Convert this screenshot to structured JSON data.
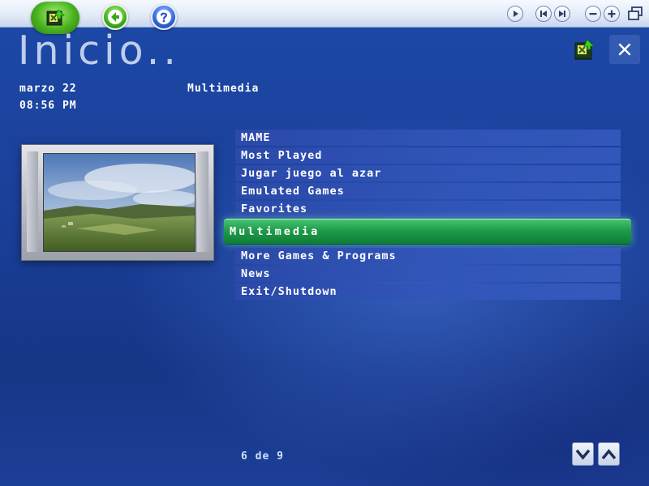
{
  "header": {
    "title": "Inicio..",
    "date": "marzo 22",
    "time": "08:56 PM",
    "section": "Multimedia"
  },
  "toolbar": {
    "home_icon": "media-center-home-icon",
    "back_icon": "back-arrow-icon",
    "help_icon": "help-icon",
    "transport_icons": [
      "play-icon",
      "previous-icon",
      "next-icon",
      "volume-down-icon",
      "volume-up-icon",
      "restore-window-icon"
    ]
  },
  "menu": {
    "items": [
      {
        "label": "MAME"
      },
      {
        "label": "Most Played"
      },
      {
        "label": "Jugar juego al azar"
      },
      {
        "label": "Emulated Games"
      },
      {
        "label": "Favorites"
      },
      {
        "label": "Multimedia",
        "selected": true
      },
      {
        "label": "More Games & Programs"
      },
      {
        "label": "News"
      },
      {
        "label": "Exit/Shutdown"
      }
    ]
  },
  "footer": {
    "page_counter": "6 de 9"
  },
  "colors": {
    "background": "#1a3f98",
    "menu_item": "#2c4aaa",
    "selected": "#1f9c4c",
    "topbar": "#e1e9f7"
  }
}
